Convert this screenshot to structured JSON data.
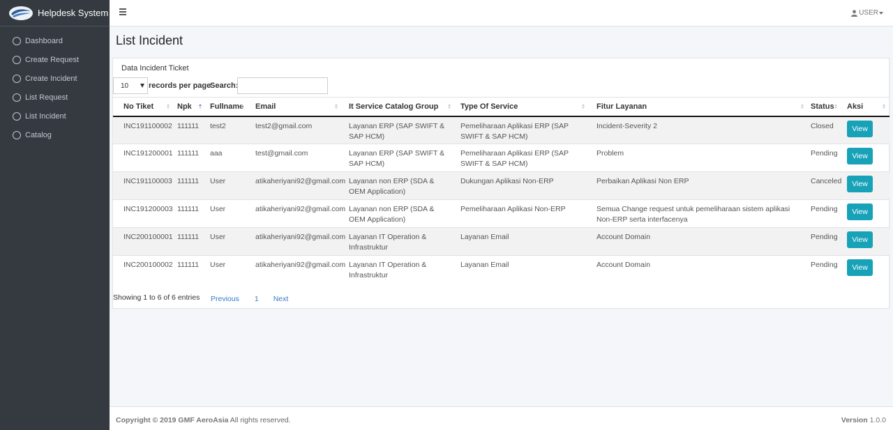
{
  "app": {
    "brand": "Helpdesk System"
  },
  "sidebar": {
    "items": [
      {
        "label": "Dashboard"
      },
      {
        "label": "Create Request"
      },
      {
        "label": "Create Incident"
      },
      {
        "label": "List Request"
      },
      {
        "label": "List Incident"
      },
      {
        "label": "Catalog"
      }
    ]
  },
  "topbar": {
    "user_label": "USER"
  },
  "page": {
    "title": "List Incident",
    "card_title": "Data Incident Ticket"
  },
  "table_controls": {
    "length_value": "10",
    "length_label": "records per page",
    "search_label": "Search:",
    "search_value": ""
  },
  "table": {
    "columns": [
      "No Tiket",
      "Npk",
      "Fullname",
      "Email",
      "It Service Catalog Group",
      "Type Of Service",
      "Fitur Layanan",
      "Status",
      "Aksi"
    ],
    "sorted_column": "Npk",
    "rows": [
      {
        "no_tiket": "INC191100002",
        "npk": "111111",
        "fullname": "test2",
        "email": "test2@gmail.com",
        "group": "Layanan ERP (SAP SWIFT & SAP HCM)",
        "type": "Pemeliharaan Aplikasi ERP (SAP SWIFT & SAP HCM)",
        "fitur": "Incident-Severity 2",
        "status": "Closed",
        "action": "View"
      },
      {
        "no_tiket": "INC191200001",
        "npk": "111111",
        "fullname": "aaa",
        "email": "test@gmail.com",
        "group": "Layanan ERP (SAP SWIFT & SAP HCM)",
        "type": "Pemeliharaan Aplikasi ERP (SAP SWIFT & SAP HCM)",
        "fitur": "Problem",
        "status": "Pending",
        "action": "View"
      },
      {
        "no_tiket": "INC191100003",
        "npk": "111111",
        "fullname": "User",
        "email": "atikaheriyani92@gmail.com",
        "group": "Layanan non ERP (SDA & OEM Application)",
        "type": "Dukungan Aplikasi Non-ERP",
        "fitur": "Perbaikan Aplikasi Non ERP",
        "status": "Canceled",
        "action": "View"
      },
      {
        "no_tiket": "INC191200003",
        "npk": "111111",
        "fullname": "User",
        "email": "atikaheriyani92@gmail.com",
        "group": "Layanan non ERP (SDA & OEM Application)",
        "type": "Pemeliharaan Aplikasi Non-ERP",
        "fitur": "Semua Change request untuk pemeliharaan sistem aplikasi Non-ERP serta interfacenya",
        "status": "Pending",
        "action": "View"
      },
      {
        "no_tiket": "INC200100001",
        "npk": "111111",
        "fullname": "User",
        "email": "atikaheriyani92@gmail.com",
        "group": "Layanan IT Operation & Infrastruktur",
        "type": "Layanan Email",
        "fitur": "Account Domain",
        "status": "Pending",
        "action": "View"
      },
      {
        "no_tiket": "INC200100002",
        "npk": "111111",
        "fullname": "User",
        "email": "atikaheriyani92@gmail.com",
        "group": "Layanan IT Operation & Infrastruktur",
        "type": "Layanan Email",
        "fitur": "Account Domain",
        "status": "Pending",
        "action": "View"
      }
    ]
  },
  "pagination": {
    "info": "Showing 1 to 6 of 6 entries",
    "previous": "Previous",
    "current": "1",
    "next": "Next"
  },
  "footer": {
    "copyright_bold": "Copyright © 2019 GMF AeroAsia",
    "copyright_rest": " All rights reserved.",
    "version_label": "Version",
    "version_value": " 1.0.0"
  },
  "colors": {
    "sidebar_bg": "#343a40",
    "button_bg": "#17a2b8",
    "link": "#3779c6"
  },
  "icons": {
    "brand": "gmf-logo",
    "menu": "hamburger-icon",
    "user": "user-icon",
    "nav": "circle-icon"
  }
}
